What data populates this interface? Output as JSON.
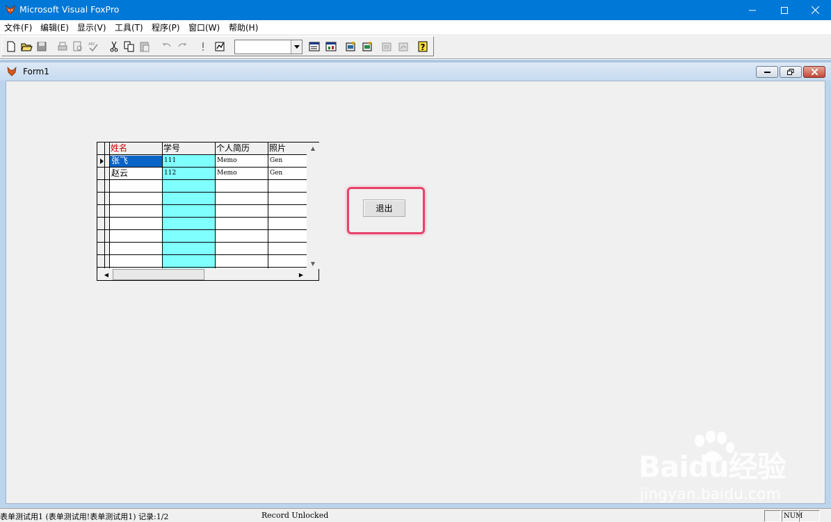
{
  "window": {
    "title": "Microsoft Visual FoxPro"
  },
  "menu": [
    "文件(F)",
    "编辑(E)",
    "显示(V)",
    "工具(T)",
    "程序(P)",
    "窗口(W)",
    "帮助(H)"
  ],
  "toolbar": {
    "buttons": [
      "new-icon",
      "open-icon",
      "save-icon",
      "print-icon",
      "print-preview-icon",
      "spell-check-icon",
      "cut-icon",
      "copy-icon",
      "paste-icon",
      "undo-icon",
      "redo-icon",
      "run-icon",
      "modify-form-icon",
      "command-window-icon",
      "view-window-icon",
      "form-wizard-icon",
      "report-wizard-icon",
      "autoform-icon",
      "autoreport-icon",
      "help-icon"
    ],
    "combo_value": ""
  },
  "form": {
    "title": "Form1",
    "grid": {
      "columns": [
        "姓名",
        "学号",
        "个人简历",
        "照片"
      ],
      "rows": [
        [
          "张飞",
          "111",
          "Memo",
          "Gen"
        ],
        [
          "赵云",
          "112",
          "Memo",
          "Gen"
        ]
      ],
      "header_color": "#d40000",
      "id_column_color": "#80ffff",
      "selected_color": "#0a64c8"
    },
    "exit_button_label": "退出",
    "highlight_color": "#e8416a"
  },
  "watermark": {
    "logo": "Baidu经验",
    "url": "jingyan.baidu.com"
  },
  "statusbar": {
    "left": "表单测试用1 (表单测试用!表单测试用1) 记录:1/2",
    "middle": "Record Unlocked",
    "num": "NUM"
  }
}
